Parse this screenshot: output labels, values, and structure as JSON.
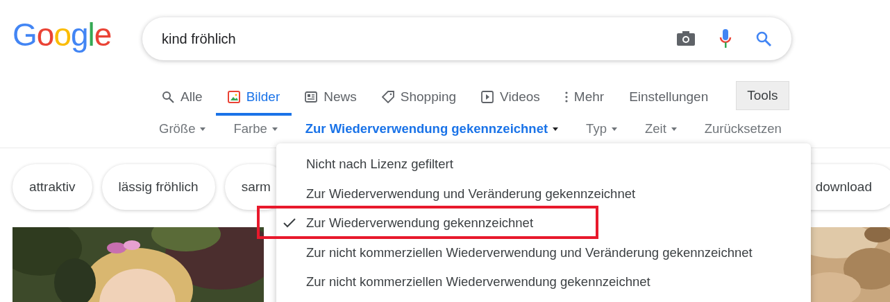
{
  "logo": "Google",
  "search": {
    "value": "kind fröhlich"
  },
  "tabs": [
    {
      "label": "Alle",
      "kind": "tab",
      "selected": false
    },
    {
      "label": "Bilder",
      "kind": "tab",
      "selected": true
    },
    {
      "label": "News",
      "kind": "tab",
      "selected": false
    },
    {
      "label": "Shopping",
      "kind": "tab",
      "selected": false
    },
    {
      "label": "Videos",
      "kind": "tab",
      "selected": false
    },
    {
      "label": "Mehr",
      "kind": "tab",
      "selected": false
    },
    {
      "label": "Einstellungen",
      "kind": "link",
      "selected": false
    },
    {
      "label": "Tools",
      "kind": "button",
      "selected": true
    }
  ],
  "filters": [
    {
      "label": "Größe",
      "selected": false,
      "kind": "dropdown"
    },
    {
      "label": "Farbe",
      "selected": false,
      "kind": "dropdown"
    },
    {
      "label": "Zur Wiederverwendung gekennzeichnet",
      "selected": true,
      "kind": "dropdown"
    },
    {
      "label": "Typ",
      "selected": false,
      "kind": "dropdown"
    },
    {
      "label": "Zeit",
      "selected": false,
      "kind": "dropdown"
    },
    {
      "label": "Zurücksetzen",
      "selected": false,
      "kind": "link"
    }
  ],
  "chips": [
    "attraktiv",
    "lässig fröhlich",
    "sarm"
  ],
  "chips_right": [
    "download"
  ],
  "menu": {
    "items": [
      {
        "label": "Nicht nach Lizenz gefiltert",
        "selected": false,
        "highlighted": false
      },
      {
        "label": "Zur Wiederverwendung und Veränderung gekennzeichnet",
        "selected": false,
        "highlighted": false
      },
      {
        "label": "Zur Wiederverwendung gekennzeichnet",
        "selected": true,
        "highlighted": true
      },
      {
        "label": "Zur nicht kommerziellen Wiederverwendung und Veränderung gekennzeichnet",
        "selected": false,
        "highlighted": false
      },
      {
        "label": "Zur nicht kommerziellen Wiederverwendung gekennzeichnet",
        "selected": false,
        "highlighted": false
      }
    ]
  }
}
